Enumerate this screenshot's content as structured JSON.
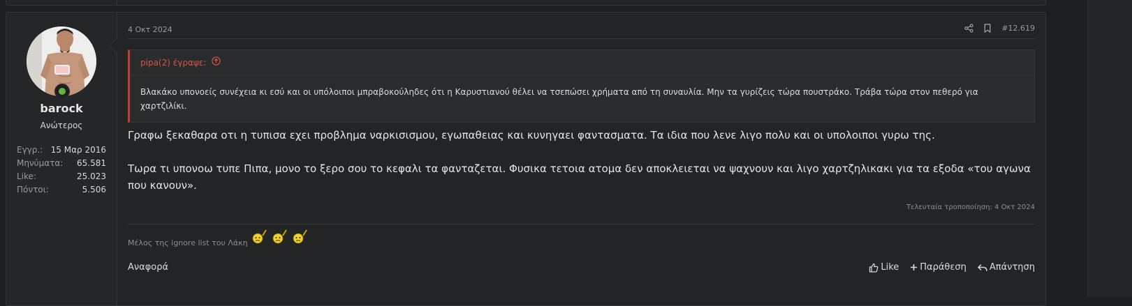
{
  "previous_post": {},
  "post": {
    "user": {
      "name": "barock",
      "title": "Ανώτερος",
      "online": true,
      "stats": [
        {
          "label": "Εγγρ.:",
          "value": "15 Μαρ 2016"
        },
        {
          "label": "Μηνύματα:",
          "value": "65.581"
        },
        {
          "label": "Like:",
          "value": "25.023"
        },
        {
          "label": "Πόντοι:",
          "value": "5.506"
        }
      ]
    },
    "date": "4 Οκτ 2024",
    "post_number": "#12.619",
    "icons": {
      "share": "share-icon",
      "bookmark": "bookmark-icon"
    },
    "quote": {
      "author": "pipa(2) έγραψε:",
      "text": "Βλακάκο υπονοείς συνέχεια κι εσύ και οι υπόλοιποι μπραβοκούληδες ότι η Καρυστιανού θέλει να τσεπώσει χρήματα από τη συναυλία. Μην τα γυρίζεις τώρα πουστράκο. Τράβα τώρα στον πεθερό για χαρτζιλίκι."
    },
    "message": [
      "Γραφω ξεκαθαρα οτι η τυπισα εχει προβλημα ναρκισισμου, εγωπαθειας και κυνηγαει φαντασματα. Τα ιδια που λενε λιγο πολυ και οι υπολοιποι γυρω της.",
      "Τωρα τι υπονοω τυπε Πιπα, μονο το ξερο σου το κεφαλι τα φανταζεται. Φυσικα τετοια ατομα δεν αποκλειεται να ψαχνουν και λιγο χαρτζηλικακι για τα εξοδα «του αγωνα που κανουν»."
    ],
    "edited": "Τελευταία τροποποίηση: 4 Οκτ 2024",
    "signature": "Μέλος της ignore list του Λάκη",
    "report_label": "Αναφορά",
    "actions": {
      "like": "Like",
      "quote": "Παράθεση",
      "reply": "Απάντηση"
    }
  },
  "colors": {
    "quote_accent": "#c23b3b",
    "online": "#63b243",
    "background": "#1d1e1f"
  }
}
